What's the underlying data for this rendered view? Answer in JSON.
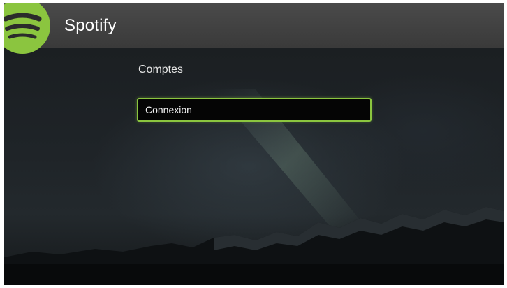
{
  "app": {
    "title": "Spotify",
    "brand_color": "#8bc53f",
    "logo_icon": "spotify-logo-icon"
  },
  "section": {
    "title": "Comptes"
  },
  "menu": {
    "items": [
      {
        "label": "Connexion",
        "focused": true
      }
    ]
  }
}
